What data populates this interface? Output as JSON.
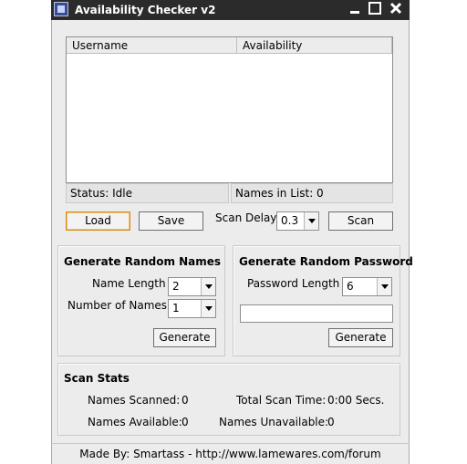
{
  "window": {
    "title": "Availability Checker v2",
    "controls": {
      "minimize_icon": "minimize-icon",
      "maximize_icon": "maximize-icon",
      "close_icon": "close-icon"
    }
  },
  "grid": {
    "columns": [
      "Username",
      "Availability"
    ]
  },
  "status": {
    "status_text": "Status: Idle",
    "names_in_list": "Names in List: 0"
  },
  "toolbar": {
    "load_label": "Load",
    "save_label": "Save",
    "scan_delay_label": "Scan Delay",
    "scan_delay_value": "0.3",
    "scan_label": "Scan"
  },
  "random_names": {
    "title": "Generate Random Names",
    "name_length_label": "Name Length",
    "name_length_value": "2",
    "number_label": "Number of Names",
    "number_value": "1",
    "generate_label": "Generate"
  },
  "random_password": {
    "title": "Generate Random Password",
    "length_label": "Password Length",
    "length_value": "6",
    "output_value": "",
    "generate_label": "Generate"
  },
  "scan_stats": {
    "title": "Scan Stats",
    "names_scanned_label": "Names Scanned:",
    "names_scanned_value": "0",
    "total_time_label": "Total Scan Time:",
    "total_time_value": "0:00 Secs.",
    "names_available_label": "Names Available:",
    "names_available_value": "0",
    "names_unavailable_label": "Names Unavailable:",
    "names_unavailable_value": "0"
  },
  "footer": {
    "text": "Made By: Smartass - http://www.lamewares.com/forum"
  },
  "colors": {
    "titlebar": "#2b2b2b",
    "window_bg": "#ececec",
    "load_button_border": "#d58a18"
  }
}
